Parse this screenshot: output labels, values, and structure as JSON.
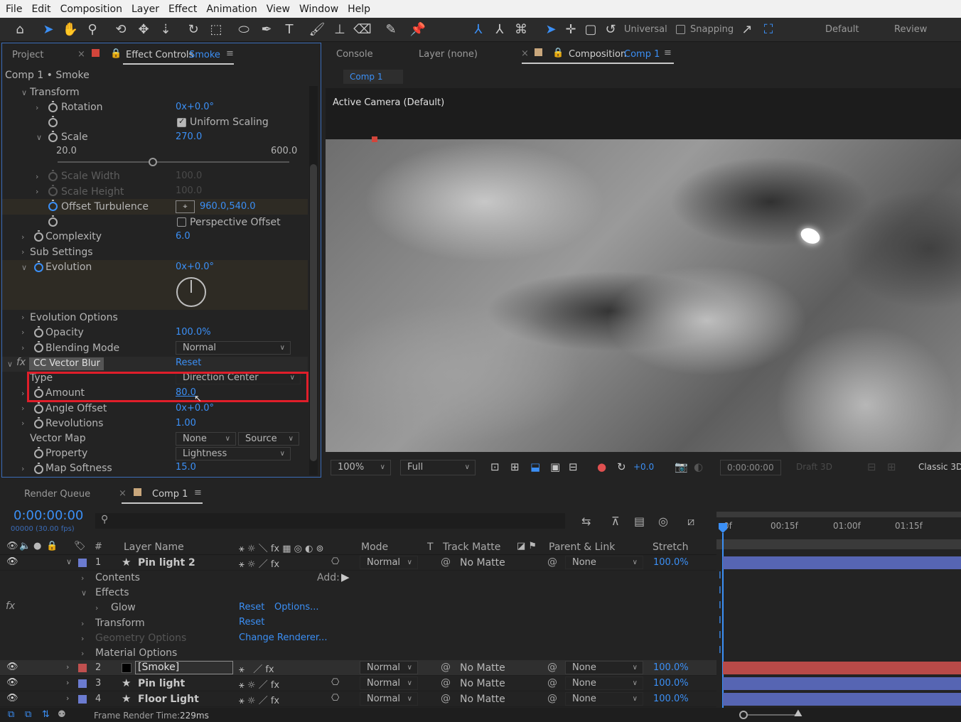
{
  "menu": [
    "File",
    "Edit",
    "Composition",
    "Layer",
    "Effect",
    "Animation",
    "View",
    "Window",
    "Help"
  ],
  "toolbar": {
    "universal": "Universal",
    "snapping": "Snapping",
    "workspace_default": "Default",
    "workspace_review": "Review"
  },
  "left_tabs": {
    "project": "Project",
    "effect_controls": "Effect Controls",
    "effect_controls_layer": "Smoke"
  },
  "breadcrumb": "Comp 1 • Smoke",
  "effect_props": {
    "transform": "Transform",
    "rotation": "Rotation",
    "rotation_val": "0x+0.0°",
    "uniform_scaling": "Uniform Scaling",
    "scale": "Scale",
    "scale_val": "270.0",
    "scale_min": "20.0",
    "scale_max": "600.0",
    "scale_level": 0.41,
    "scale_width": "Scale Width",
    "scale_width_val": "100.0",
    "scale_height": "Scale Height",
    "scale_height_val": "100.0",
    "offset_turbulence": "Offset Turbulence",
    "offset_val": "960.0,540.0",
    "perspective_offset": "Perspective Offset",
    "complexity": "Complexity",
    "complexity_val": "6.0",
    "sub_settings": "Sub Settings",
    "evolution": "Evolution",
    "evolution_val": "0x+0.0°",
    "evolution_options": "Evolution Options",
    "opacity": "Opacity",
    "opacity_val": "100.0%",
    "blending_mode": "Blending Mode",
    "blending_val": "Normal",
    "cc_vector_blur": "CC Vector Blur",
    "reset": "Reset",
    "type": "Type",
    "type_val": "Direction Center",
    "amount": "Amount",
    "amount_val": "80.0",
    "angle_offset": "Angle Offset",
    "angle_offset_val": "0x+0.0°",
    "revolutions": "Revolutions",
    "revolutions_val": "1.00",
    "vector_map": "Vector Map",
    "vector_map_val": "None",
    "vector_map_src": "Source",
    "property": "Property",
    "property_val": "Lightness",
    "map_softness": "Map Softness",
    "map_softness_val": "15.0"
  },
  "right_tabs": {
    "console": "Console",
    "layer": "Layer (none)",
    "composition": "Composition",
    "composition_name": "Comp 1",
    "comp_subtab": "Comp 1"
  },
  "viewer": {
    "camera": "Active Camera (Default)",
    "zoom": "100%",
    "resolution": "Full",
    "exposure": "+0.0",
    "timecode": "0:00:00:00",
    "draft3d": "Draft 3D",
    "renderer": "Classic 3D"
  },
  "timeline": {
    "render_queue": "Render Queue",
    "comp_tab": "Comp 1",
    "timecode": "0:00:00:00",
    "frames": "00000 (30.00 fps)",
    "search_placeholder": "",
    "cols": {
      "num": "#",
      "layer_name": "Layer Name",
      "mode": "Mode",
      "t": "T",
      "track_matte": "Track Matte",
      "parent": "Parent & Link",
      "stretch": "Stretch"
    },
    "ruler": [
      "0f",
      "00:15f",
      "01:00f",
      "01:15f"
    ],
    "layers": [
      {
        "num": "1",
        "name": "Pin light 2",
        "mode": "Normal",
        "matte": "No Matte",
        "parent": "None",
        "stretch": "100.0%"
      },
      {
        "num": "2",
        "name": "[Smoke]",
        "mode": "Normal",
        "matte": "No Matte",
        "parent": "None",
        "stretch": "100.0%"
      },
      {
        "num": "3",
        "name": "Pin light",
        "mode": "Normal",
        "matte": "No Matte",
        "parent": "None",
        "stretch": "100.0%"
      },
      {
        "num": "4",
        "name": "Floor Light",
        "mode": "Normal",
        "matte": "No Matte",
        "parent": "None",
        "stretch": "100.0%"
      }
    ],
    "sub": {
      "contents": "Contents",
      "add": "Add:",
      "effects": "Effects",
      "glow": "Glow",
      "glow_reset": "Reset",
      "glow_options": "Options...",
      "transform": "Transform",
      "transform_reset": "Reset",
      "geometry": "Geometry Options",
      "change_renderer": "Change Renderer...",
      "material": "Material Options"
    },
    "frame_render": "Frame Render Time:",
    "frame_render_val": "229ms"
  },
  "colors": {
    "accent": "#3b8ff5",
    "highlight_box": "#e01e2a",
    "layer1": "#6b7bd0",
    "layer2": "#c0504f",
    "layer3": "#6b7bd0",
    "layer4": "#6b7bd0"
  }
}
